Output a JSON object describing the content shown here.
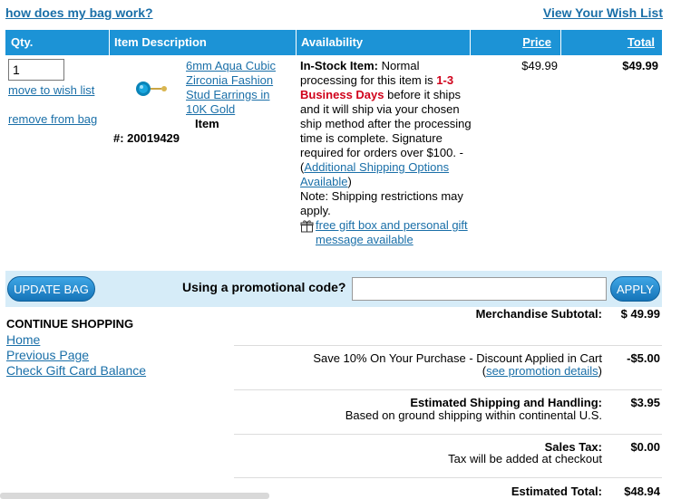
{
  "top": {
    "how_bag_works": "how does my bag work?",
    "view_wish_list": "View Your Wish List"
  },
  "table": {
    "headers": {
      "qty": "Qty.",
      "description": "Item Description",
      "availability": "Availability",
      "price": "Price",
      "total": "Total"
    },
    "item": {
      "qty": "1",
      "move_to_wish_list": "move to wish list",
      "remove_from_bag": "remove from bag",
      "name": "6mm Aqua Cubic Zirconia Fashion Stud Earrings in 10K Gold",
      "item_label": "Item",
      "item_number": "#: 20019429",
      "availability": {
        "stock_label": "In-Stock Item:",
        "text1": " Normal processing for this item is ",
        "days": "1-3 Business Days",
        "text2": " before it ships and it will ship via your chosen ship method after the processing time is complete. Signature required for orders over $100. - (",
        "shipping_link": "Additional Shipping Options Available",
        "text3": ")",
        "note": "Note: Shipping restrictions may apply.",
        "gift_link": "free gift box and personal gift message available"
      },
      "price": "$49.99",
      "total": "$49.99"
    }
  },
  "actions": {
    "update_bag": "UPDATE BAG",
    "promo_label": "Using a promotional code?",
    "promo_value": "",
    "apply": "APPLY"
  },
  "continue_shopping": {
    "title": "CONTINUE SHOPPING",
    "links": [
      "Home",
      "Previous Page",
      "Check Gift Card Balance"
    ]
  },
  "summary": {
    "merch_label": "Merchandise Subtotal:",
    "merch_value": "$ 49.99",
    "discount_label": "Save 10% On Your Purchase - Discount Applied in Cart",
    "discount_value": "-$5.00",
    "discount_link_pre": "(",
    "discount_link": "see promotion details",
    "discount_link_post": ")",
    "shipping_label": "Estimated Shipping and Handling:",
    "shipping_note": "Based on ground shipping within continental U.S.",
    "shipping_value": "$3.95",
    "tax_label": "Sales Tax:",
    "tax_note": "Tax will be added at checkout",
    "tax_value": "$0.00",
    "total_label": "Estimated Total:",
    "total_value": "$48.94"
  },
  "colors": {
    "header_blue": "#1c93d6",
    "link": "#1a6fa8",
    "accent_red": "#d0021b",
    "bar_bg": "#d6ecf8"
  },
  "icons": {
    "product": "aqua-stud-earring",
    "gift": "gift-box-icon"
  }
}
